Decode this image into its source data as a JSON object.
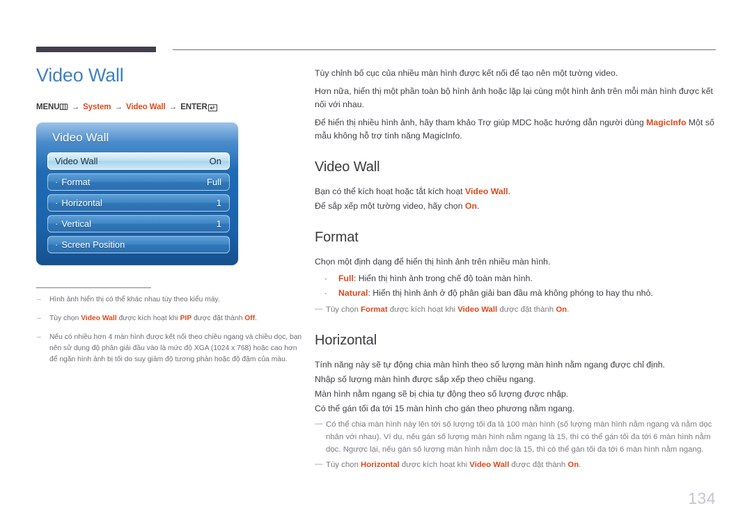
{
  "document": {
    "page_number": "134",
    "title": "Video Wall"
  },
  "breadcrumb": {
    "menu_label": "MENU",
    "menu_icon": "menu-grid-icon",
    "arrow": "→",
    "item1": "System",
    "item2": "Video Wall",
    "enter_label": "ENTER",
    "enter_icon": "enter-return-icon",
    "enter_glyph": "↵"
  },
  "osd": {
    "title": "Video Wall",
    "rows": [
      {
        "label": "Video Wall",
        "value": "On",
        "selected": true,
        "sub": false
      },
      {
        "label": "Format",
        "value": "Full",
        "selected": false,
        "sub": true
      },
      {
        "label": "Horizontal",
        "value": "1",
        "selected": false,
        "sub": true
      },
      {
        "label": "Vertical",
        "value": "1",
        "selected": false,
        "sub": true
      },
      {
        "label": "Screen Position",
        "value": "",
        "selected": false,
        "sub": true
      }
    ],
    "sub_dot": "·"
  },
  "left_notes": {
    "dash": "‒",
    "note1": "Hình ảnh hiển thị có thể khác nhau tùy theo kiểu máy.",
    "note2_a": "Tùy chọn ",
    "note2_b": "Video Wall",
    "note2_c": " được kích hoạt khi ",
    "note2_d": "PIP",
    "note2_e": " được đặt thành ",
    "note2_f": "Off",
    "note2_g": ".",
    "note3": "Nếu có nhiều hơn 4 màn hình được kết nối theo chiều ngang và chiều dọc, bạn nên sử dụng độ phân giải đầu vào là mức độ XGA (1024 x 768) hoặc cao hơn để ngăn hình ảnh bị tối do suy giảm độ tương phản hoặc độ đậm của màu."
  },
  "intro": {
    "p1": "Tùy chỉnh bố cục của nhiều màn hình được kết nối để tạo nên một tường video.",
    "p2": "Hơn nữa, hiển thị một phần toàn bộ hình ảnh hoặc lặp lại cùng một hình ảnh trên mỗi màn hình được kết nối với nhau.",
    "p3_a": "Để hiển thị nhiều hình ảnh, hãy tham khảo Trợ giúp MDC hoặc hướng dẫn người dùng ",
    "p3_b": "MagicInfo",
    "p3_c": " Một số mẫu không hỗ trợ tính năng MagicInfo."
  },
  "section_video_wall": {
    "heading": "Video Wall",
    "line1_a": "Bạn có thể kích hoạt hoặc tắt kích hoạt ",
    "line1_b": "Video Wall",
    "line1_c": ".",
    "line2_a": "Để sắp xếp một tường video, hãy chọn ",
    "line2_b": "On",
    "line2_c": "."
  },
  "section_format": {
    "heading": "Format",
    "line1": "Chọn một định dạng để hiển thị hình ảnh trên nhiều màn hình.",
    "bullet_dot": "·",
    "bullet1_a": "Full",
    "bullet1_b": ": Hiển thị hình ảnh trong chế độ toàn màn hình.",
    "bullet2_a": "Natural",
    "bullet2_b": ": Hiển thị hình ảnh ở độ phân giải ban đầu mà không phóng to hay thu nhỏ.",
    "note_dash": "―",
    "note_a": "Tùy chọn ",
    "note_b": "Format",
    "note_c": " được kích hoạt khi ",
    "note_d": "Video Wall",
    "note_e": " được đặt thành ",
    "note_f": "On",
    "note_g": "."
  },
  "section_horizontal": {
    "heading": "Horizontal",
    "line1": "Tính năng này sẽ tự động chia màn hình theo số lượng màn hình nằm ngang được chỉ định.",
    "line2": "Nhập số lượng màn hình được sắp xếp theo chiều ngang.",
    "line3": "Màn hình nằm ngang sẽ bị chia tự động theo số lượng được nhập.",
    "line4": "Có thể gán tối đa tới 15 màn hình cho gán theo phương nằm ngang.",
    "note_dash": "―",
    "note1": "Có thể chia màn hình này lên tới số lượng tối đa là 100 màn hình (số lượng màn hình nằm ngang và nằm dọc nhân với nhau). Ví dụ, nếu gán số lượng màn hình nằm ngang là 15, thì có thể gán tối đa tới 6 màn hình nằm dọc. Ngược lại, nếu gán số lượng màn hình nằm dọc là 15, thì có thể gán tối đa tới 6 màn hình nằm ngang.",
    "note2_a": "Tùy chọn ",
    "note2_b": "Horizontal",
    "note2_c": " được kích hoạt khi ",
    "note2_d": "Video Wall",
    "note2_e": " được đặt thành ",
    "note2_f": "On",
    "note2_g": "."
  },
  "colors": {
    "accent_orange": "#e0491c",
    "title_blue": "#3f81c4",
    "osd_blue": "#1f6cb4",
    "rule_dark": "#433e4c",
    "page_number_gray": "#c6c6d4"
  }
}
